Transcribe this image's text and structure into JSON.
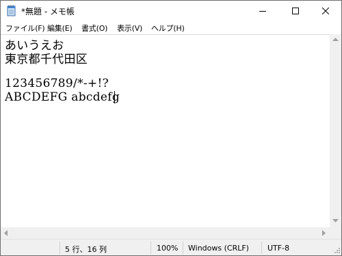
{
  "window": {
    "title": "*無題 - メモ帳",
    "accent": "#000000"
  },
  "menu": {
    "items": [
      {
        "label": "ファイル(F)"
      },
      {
        "label": "編集(E)"
      },
      {
        "label": "書式(O)"
      },
      {
        "label": "表示(V)"
      },
      {
        "label": "ヘルプ(H)"
      }
    ]
  },
  "editor": {
    "lines": [
      "あいうえお",
      "東京都千代田区",
      "",
      "123456789/*-+!?",
      "ABCDEFG abcdefg"
    ]
  },
  "status": {
    "position": "5 行、16 列",
    "zoom": "100%",
    "line_ending": "Windows (CRLF)",
    "encoding": "UTF-8"
  },
  "icons": {
    "app": "notepad-icon",
    "minimize": "minimize-icon",
    "maximize": "maximize-icon",
    "close": "close-icon"
  }
}
